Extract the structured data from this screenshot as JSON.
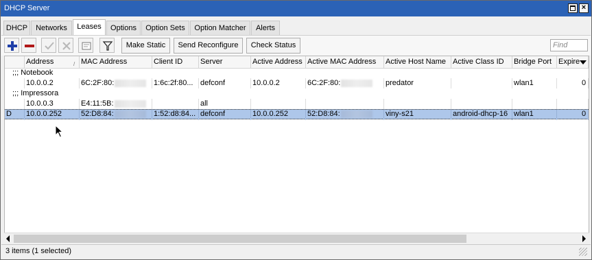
{
  "window": {
    "title": "DHCP Server"
  },
  "tabs": [
    {
      "label": "DHCP"
    },
    {
      "label": "Networks"
    },
    {
      "label": "Leases"
    },
    {
      "label": "Options"
    },
    {
      "label": "Option Sets"
    },
    {
      "label": "Option Matcher"
    },
    {
      "label": "Alerts"
    }
  ],
  "active_tab": "Leases",
  "toolbar": {
    "make_static": "Make Static",
    "send_reconfigure": "Send Reconfigure",
    "check_status": "Check Status",
    "find_placeholder": "Find",
    "icons": [
      "add-icon",
      "remove-icon",
      "enable-icon",
      "disable-icon",
      "comment-icon",
      "filter-icon"
    ]
  },
  "table": {
    "columns": [
      "Address",
      "MAC Address",
      "Client ID",
      "Server",
      "Active Address",
      "Active MAC Address",
      "Active Host Name",
      "Active Class ID",
      "Bridge Port",
      "Expire"
    ],
    "sorted_column": "Address",
    "rows": [
      {
        "comment": ";;; Notebook"
      },
      {
        "flag": "",
        "address": "10.0.0.2",
        "mac": "6C:2F:80:",
        "client_id": "1:6c:2f:80...",
        "server": "defconf",
        "active_address": "10.0.0.2",
        "active_mac": "6C:2F:80:",
        "active_host": "predator",
        "active_class": "",
        "bridge_port": "wlan1",
        "expire": "0"
      },
      {
        "comment": ";;; Impressora"
      },
      {
        "flag": "",
        "address": "10.0.0.3",
        "mac": "E4:11:5B:",
        "client_id": "",
        "server": "all",
        "active_address": "",
        "active_mac": "",
        "active_host": "",
        "active_class": "",
        "bridge_port": "",
        "expire": ""
      },
      {
        "flag": "D",
        "address": "10.0.0.252",
        "mac": "52:D8:84:",
        "client_id": "1:52:d8:84...",
        "server": "defconf",
        "active_address": "10.0.0.252",
        "active_mac": "52:D8:84:",
        "active_host": "viny-s21",
        "active_class": "android-dhcp-16",
        "bridge_port": "wlan1",
        "expire": "0"
      }
    ]
  },
  "status": {
    "text": "3 items (1 selected)"
  },
  "colors": {
    "titlebar": "#2b62b6",
    "selection": "#aec7ea",
    "add": "#1f3fa8",
    "remove": "#b01818"
  }
}
